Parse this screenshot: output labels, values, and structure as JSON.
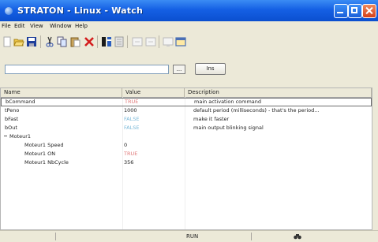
{
  "window": {
    "title": "STRATON - Linux - Watch"
  },
  "menu": [
    "File",
    "Edit",
    "View",
    "Window",
    "Help"
  ],
  "toolbar": {
    "icons": [
      "new-icon",
      "open-icon",
      "save-icon",
      "cut-icon",
      "copy-icon",
      "paste-icon",
      "delete-icon",
      "columns-icon",
      "properties-icon",
      "undo-icon",
      "redo-icon",
      "monitor-icon",
      "window-icon"
    ]
  },
  "input": {
    "value": "",
    "browse_label": "...",
    "insert_label": "Ins"
  },
  "grid": {
    "columns": [
      "Name",
      "Value",
      "Description"
    ],
    "rows": [
      {
        "name": "bCommand",
        "value": "TRUE",
        "value_color": "#e07a7a",
        "description": "main activation command",
        "selected": true
      },
      {
        "name": "tPeno",
        "value": "1000",
        "value_color": "#222222",
        "description": "default period (milliseconds) - that's the period..."
      },
      {
        "name": "bFast",
        "value": "FALSE",
        "value_color": "#7ab8d8",
        "description": "make it faster"
      },
      {
        "name": "bOut",
        "value": "FALSE",
        "value_color": "#7ab8d8",
        "description": "main output blinking signal"
      },
      {
        "name": "Moteur1",
        "value": "",
        "value_color": "#222222",
        "description": "",
        "group": true
      },
      {
        "name": "Moteur1 Speed",
        "value": "0",
        "value_color": "#222222",
        "description": "",
        "child": true
      },
      {
        "name": "Moteur1 ON",
        "value": "TRUE",
        "value_color": "#e07a7a",
        "description": "",
        "child": true
      },
      {
        "name": "Moteur1 NbCycle",
        "value": "356",
        "value_color": "#222222",
        "description": "",
        "child": true
      }
    ]
  },
  "status": {
    "text": "RUN",
    "icon": "binoculars-icon"
  }
}
